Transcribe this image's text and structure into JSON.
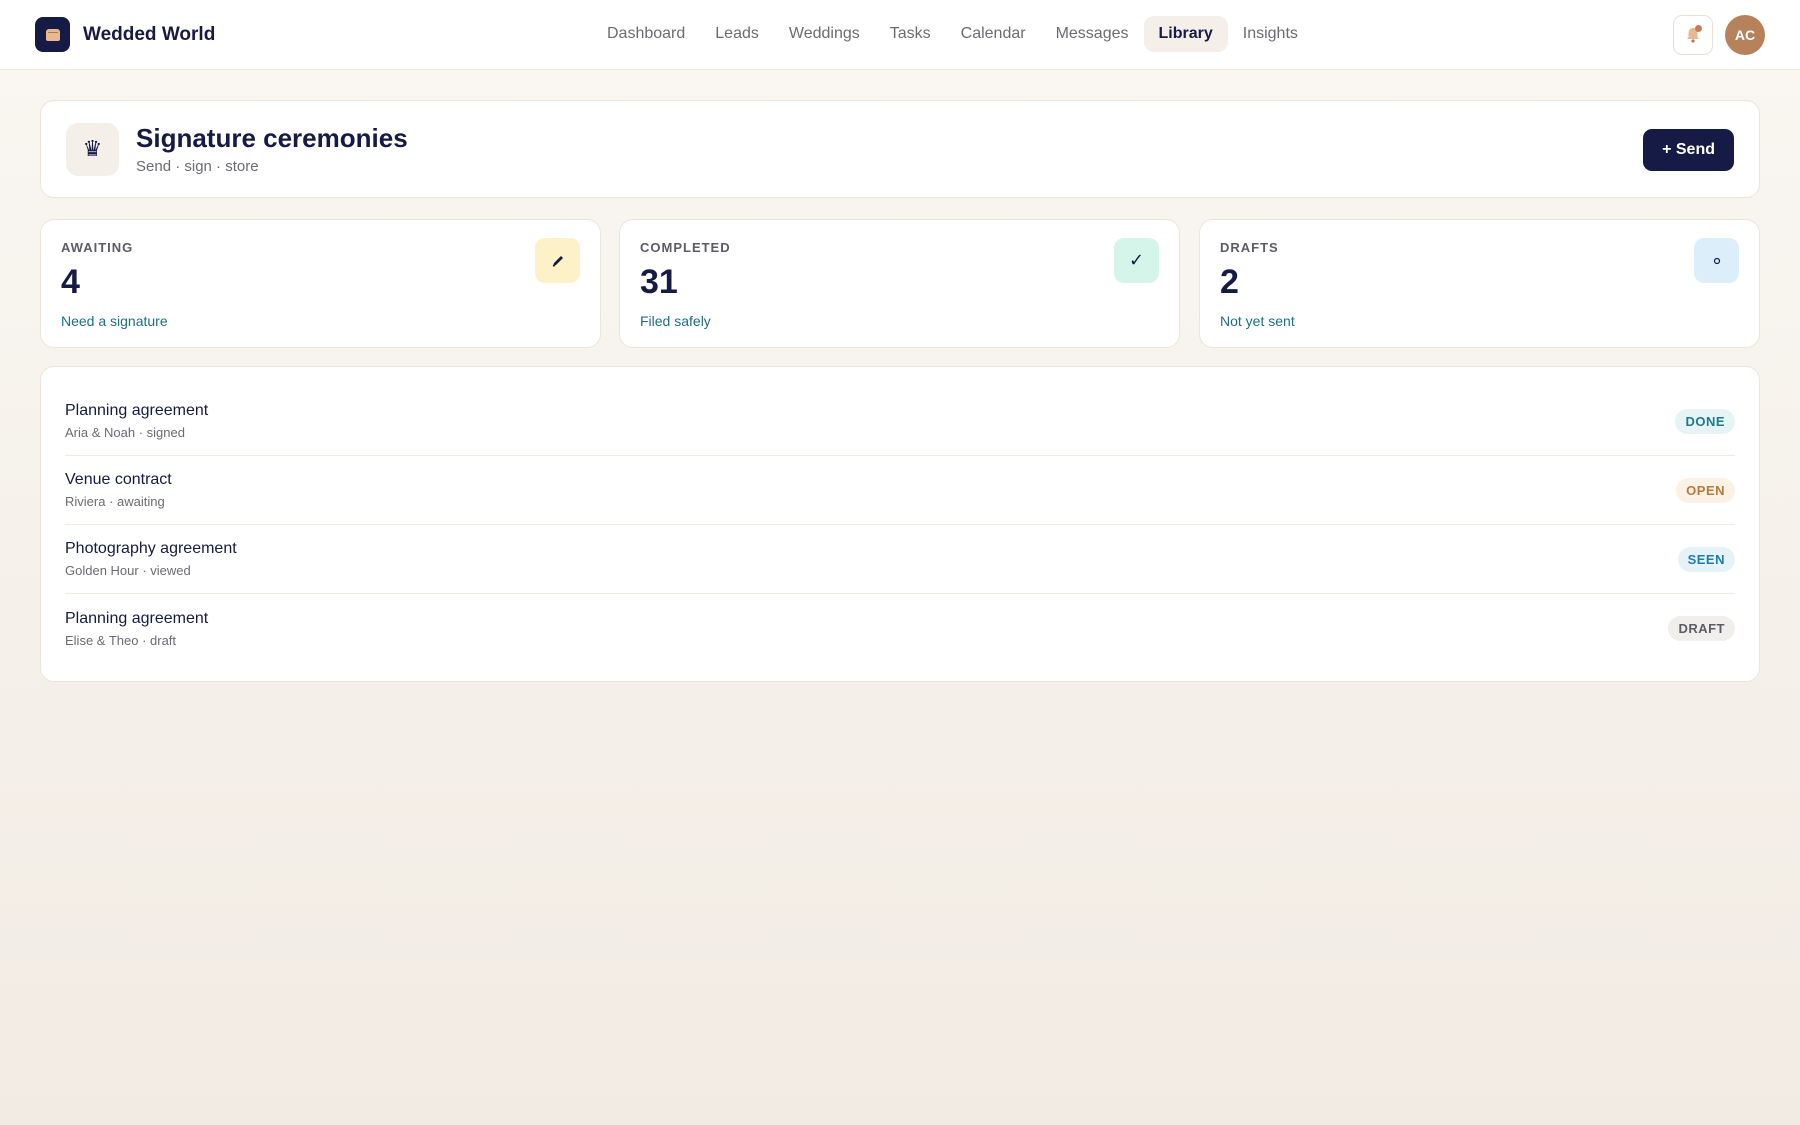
{
  "app": {
    "name": "Wedded World",
    "logo_icon": "cake-icon"
  },
  "nav": {
    "items": [
      {
        "label": "Dashboard",
        "active": false
      },
      {
        "label": "Leads",
        "active": false
      },
      {
        "label": "Weddings",
        "active": false
      },
      {
        "label": "Tasks",
        "active": false
      },
      {
        "label": "Calendar",
        "active": false
      },
      {
        "label": "Messages",
        "active": false
      },
      {
        "label": "Library",
        "active": true
      },
      {
        "label": "Insights",
        "active": false
      }
    ]
  },
  "topbar": {
    "notification_icon": "bell-icon",
    "avatar_initials": "AC"
  },
  "header": {
    "icon": "crown-icon",
    "title": "Signature ceremonies",
    "subtitle": "Send · sign · store",
    "send_label": "+ Send"
  },
  "stats": [
    {
      "label": "AWAITING",
      "value": "4",
      "caption": "Need a signature",
      "icon": "pen-icon",
      "icon_bg": "#fdf1c7"
    },
    {
      "label": "COMPLETED",
      "value": "31",
      "caption": "Filed safely",
      "icon": "check-icon",
      "icon_bg": "#d5f5ea"
    },
    {
      "label": "DRAFTS",
      "value": "2",
      "caption": "Not yet sent",
      "icon": "circle-icon",
      "icon_bg": "#dbeefa"
    }
  ],
  "documents": [
    {
      "title": "Planning agreement",
      "meta": "Aria & Noah · signed",
      "status": "DONE",
      "status_color": "#1e7a8c",
      "status_bg": "#e6f4f6"
    },
    {
      "title": "Venue contract",
      "meta": "Riviera · awaiting",
      "status": "OPEN",
      "status_color": "#b57a3c",
      "status_bg": "#fbf1e4"
    },
    {
      "title": "Photography agreement",
      "meta": "Golden Hour · viewed",
      "status": "SEEN",
      "status_color": "#1f7ea8",
      "status_bg": "#e5f2f8"
    },
    {
      "title": "Planning agreement",
      "meta": "Elise & Theo · draft",
      "status": "DRAFT",
      "status_color": "#5c5c66",
      "status_bg": "#f1efec"
    }
  ],
  "colors": {
    "brand": "#151b45",
    "accent_caption": "#1e6e84",
    "avatar": "#b5825c"
  }
}
